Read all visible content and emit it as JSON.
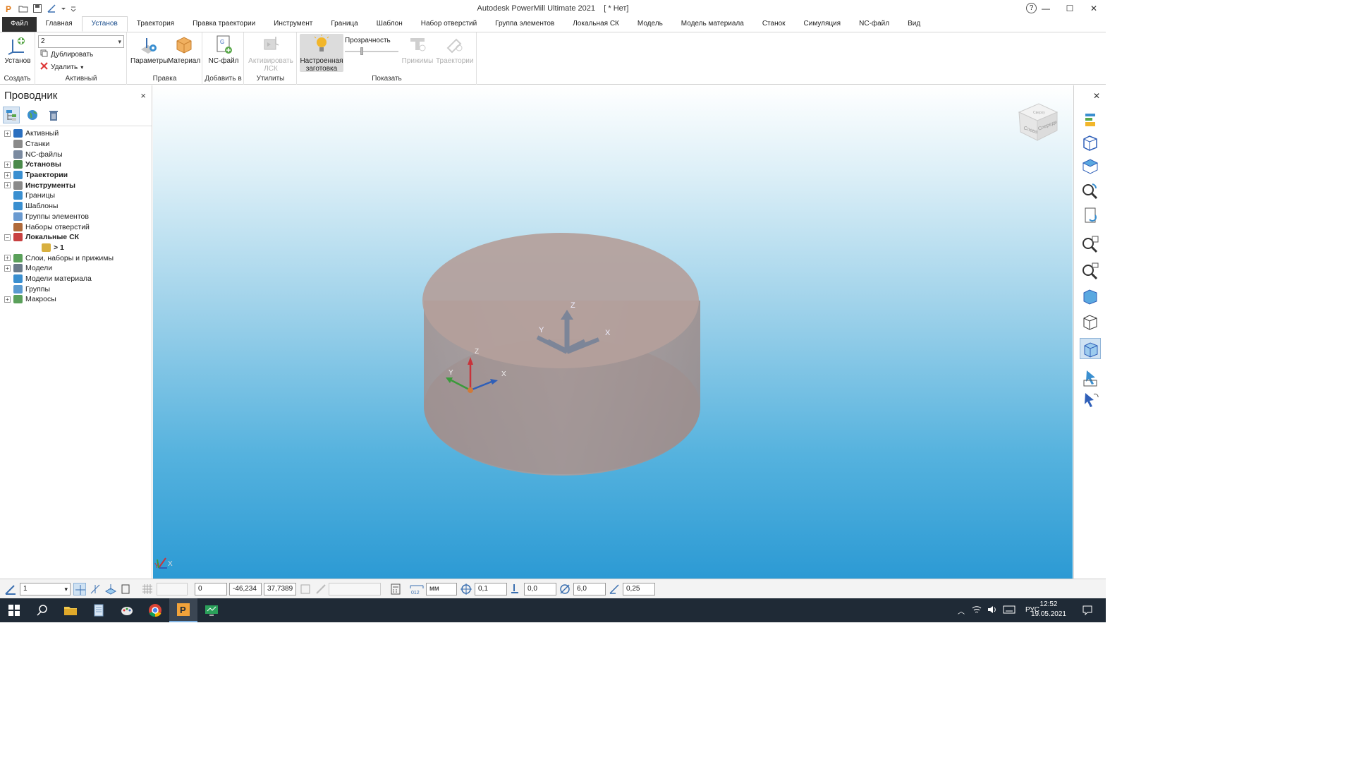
{
  "titlebar": {
    "app_title": "Autodesk PowerMill Ultimate 2021",
    "doc_title": "[ * Нет]",
    "help": "?",
    "minimize": "—",
    "maximize": "☐",
    "close": "✕"
  },
  "tabs": [
    "Файл",
    "Главная",
    "Установ",
    "Траектория",
    "Правка траектории",
    "Инструмент",
    "Граница",
    "Шаблон",
    "Набор отверстий",
    "Группа элементов",
    "Локальная СК",
    "Модель",
    "Модель материала",
    "Станок",
    "Симуляция",
    "NC-файл",
    "Вид"
  ],
  "active_tab": "Установ",
  "ribbon": {
    "create": {
      "group_label": "Создать",
      "setup_button": "Установ"
    },
    "active": {
      "group_label": "Активный",
      "selector_value": "2",
      "duplicate": "Дублировать",
      "delete": "Удалить"
    },
    "edit": {
      "group_label": "Правка",
      "parameters": "Параметры",
      "material": "Материал"
    },
    "addto": {
      "group_label": "Добавить в",
      "ncfile": "NC-файл"
    },
    "utilities": {
      "group_label": "Утилиты",
      "activate_lcs": "Активировать ЛСК"
    },
    "show": {
      "group_label": "Показать",
      "tuned_stock": "Настроенная заготовка",
      "transparency": "Прозрачность",
      "clamps": "Прижимы",
      "toolpaths": "Траектории"
    }
  },
  "explorer": {
    "title": "Проводник",
    "close": "×",
    "tree": [
      {
        "label": "Активный",
        "expandable": true,
        "bold": false,
        "color": "#2a6fbf"
      },
      {
        "label": "Станки",
        "expandable": false,
        "bold": false,
        "color": "#8a8a8a"
      },
      {
        "label": "NC-файлы",
        "expandable": false,
        "bold": false,
        "color": "#7a8aa0"
      },
      {
        "label": "Установы",
        "expandable": true,
        "bold": true,
        "color": "#4a8a4a"
      },
      {
        "label": "Траектории",
        "expandable": true,
        "bold": true,
        "color": "#3a8fd0"
      },
      {
        "label": "Инструменты",
        "expandable": true,
        "bold": true,
        "color": "#8a8a8a"
      },
      {
        "label": "Границы",
        "expandable": false,
        "bold": false,
        "color": "#3a8fd0"
      },
      {
        "label": "Шаблоны",
        "expandable": false,
        "bold": false,
        "color": "#3a8fd0"
      },
      {
        "label": "Группы элементов",
        "expandable": false,
        "bold": false,
        "color": "#6a9ad0"
      },
      {
        "label": "Наборы отверстий",
        "expandable": false,
        "bold": false,
        "color": "#b06a3a"
      },
      {
        "label": "Локальные СК",
        "expandable": true,
        "expanded": true,
        "bold": true,
        "color": "#c84040"
      },
      {
        "label": "> 1",
        "child": true,
        "bold": true,
        "color": "#d8b040"
      },
      {
        "label": "Слои, наборы и прижимы",
        "expandable": true,
        "bold": false,
        "color": "#5aa05a"
      },
      {
        "label": "Модели",
        "expandable": true,
        "bold": false,
        "color": "#6a7a8a"
      },
      {
        "label": "Модели материала",
        "expandable": false,
        "bold": false,
        "color": "#3a8fd0"
      },
      {
        "label": "Группы",
        "expandable": false,
        "bold": false,
        "color": "#5a9ad0"
      },
      {
        "label": "Макросы",
        "expandable": true,
        "bold": false,
        "color": "#5aa05a"
      }
    ]
  },
  "viewport": {
    "axis_global": {
      "x": "X",
      "y": "Y",
      "z": "Z"
    },
    "axis_local": {
      "x": "X",
      "y": "Y",
      "z": "Z"
    },
    "corner_triad": {
      "x": "X",
      "y": "Y"
    },
    "viewcube": {
      "left": "Слева",
      "front": "Спереди",
      "top": "Сверху"
    }
  },
  "statusbar": {
    "lcs_select": "1",
    "x": "0",
    "y": "-46,234",
    "z": "37,7389",
    "units": "мм",
    "tolerance": "0,1",
    "offset": "0,0",
    "diameter": "6,0",
    "angle": "0,25"
  },
  "taskbar": {
    "lang": "РУС",
    "time": "12:52",
    "date": "19.05.2021"
  },
  "colors": {
    "file_tab": "#2f2f2f",
    "accent": "#1c4f8d",
    "stock": "#b89c98",
    "axis_red": "#c8333a",
    "axis_green": "#3a9a3a",
    "axis_blue": "#2f5fb8"
  }
}
